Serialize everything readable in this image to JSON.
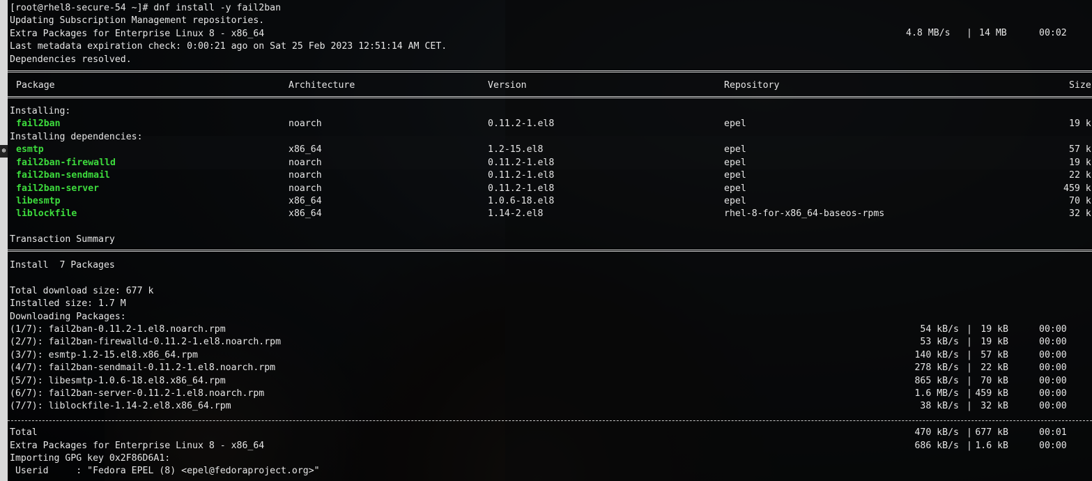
{
  "terminal": {
    "prompt_line": "[root@rhel8-secure-54 ~]# dnf install -y fail2ban",
    "preamble": [
      "Updating Subscription Management repositories.",
      "Extra Packages for Enterprise Linux 8 - x86_64",
      "Last metadata expiration check: 0:00:21 ago on Sat 25 Feb 2023 12:51:14 AM CET.",
      "Dependencies resolved."
    ],
    "epel_progress": {
      "speed": "4.8 MB/s",
      "sep": "|",
      "size": "14 MB",
      "time": "00:02"
    },
    "table": {
      "headers": [
        "Package",
        "Architecture",
        "Version",
        "Repository",
        "Size"
      ],
      "installing_label": "Installing:",
      "installing": [
        {
          "name": "fail2ban",
          "arch": "noarch",
          "version": "0.11.2-1.el8",
          "repo": "epel",
          "size": "19 k"
        }
      ],
      "deps_label": "Installing dependencies:",
      "deps": [
        {
          "name": "esmtp",
          "arch": "x86_64",
          "version": "1.2-15.el8",
          "repo": "epel",
          "size": "57 k"
        },
        {
          "name": "fail2ban-firewalld",
          "arch": "noarch",
          "version": "0.11.2-1.el8",
          "repo": "epel",
          "size": "19 k"
        },
        {
          "name": "fail2ban-sendmail",
          "arch": "noarch",
          "version": "0.11.2-1.el8",
          "repo": "epel",
          "size": "22 k"
        },
        {
          "name": "fail2ban-server",
          "arch": "noarch",
          "version": "0.11.2-1.el8",
          "repo": "epel",
          "size": "459 k"
        },
        {
          "name": "libesmtp",
          "arch": "x86_64",
          "version": "1.0.6-18.el8",
          "repo": "epel",
          "size": "70 k"
        },
        {
          "name": "liblockfile",
          "arch": "x86_64",
          "version": "1.14-2.el8",
          "repo": "rhel-8-for-x86_64-baseos-rpms",
          "size": "32 k"
        }
      ]
    },
    "summary": {
      "title": "Transaction Summary",
      "install": "Install  7 Packages",
      "download_size": "Total download size: 677 k",
      "installed_size": "Installed size: 1.7 M",
      "downloading": "Downloading Packages:"
    },
    "downloads": [
      {
        "file": "(1/7): fail2ban-0.11.2-1.el8.noarch.rpm",
        "speed": "54 kB/s",
        "size": "19 kB",
        "time": "00:00"
      },
      {
        "file": "(2/7): fail2ban-firewalld-0.11.2-1.el8.noarch.rpm",
        "speed": "53 kB/s",
        "size": "19 kB",
        "time": "00:00"
      },
      {
        "file": "(3/7): esmtp-1.2-15.el8.x86_64.rpm",
        "speed": "140 kB/s",
        "size": "57 kB",
        "time": "00:00"
      },
      {
        "file": "(4/7): fail2ban-sendmail-0.11.2-1.el8.noarch.rpm",
        "speed": "278 kB/s",
        "size": "22 kB",
        "time": "00:00"
      },
      {
        "file": "(5/7): libesmtp-1.0.6-18.el8.x86_64.rpm",
        "speed": "865 kB/s",
        "size": "70 kB",
        "time": "00:00"
      },
      {
        "file": "(6/7): fail2ban-server-0.11.2-1.el8.noarch.rpm",
        "speed": "1.6 MB/s",
        "size": "459 kB",
        "time": "00:00"
      },
      {
        "file": "(7/7): liblockfile-1.14-2.el8.x86_64.rpm",
        "speed": "38 kB/s",
        "size": "32 kB",
        "time": "00:00"
      }
    ],
    "totals": [
      {
        "label": "Total",
        "speed": "470 kB/s",
        "size": "677 kB",
        "time": "00:01"
      },
      {
        "label": "Extra Packages for Enterprise Linux 8 - x86_64",
        "speed": "686 kB/s",
        "size": "1.6 kB",
        "time": "00:00"
      }
    ],
    "tail": [
      "Importing GPG key 0x2F86D6A1:",
      " Userid     : \"Fedora EPEL (8) <epel@fedoraproject.org>\""
    ],
    "separator": "|"
  },
  "colors": {
    "package_green": "#3ddc3d",
    "text": "#e6e6e6"
  }
}
